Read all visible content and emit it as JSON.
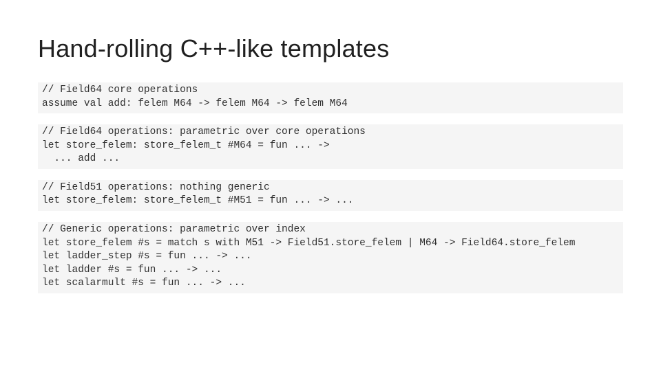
{
  "title": "Hand-rolling C++-like templates",
  "blocks": [
    "// Field64 core operations\nassume val add: felem M64 -> felem M64 -> felem M64",
    "// Field64 operations: parametric over core operations\nlet store_felem: store_felem_t #M64 = fun ... ->\n  ... add ...",
    "// Field51 operations: nothing generic\nlet store_felem: store_felem_t #M51 = fun ... -> ...",
    "// Generic operations: parametric over index\nlet store_felem #s = match s with M51 -> Field51.store_felem | M64 -> Field64.store_felem\nlet ladder_step #s = fun ... -> ...\nlet ladder #s = fun ... -> ...\nlet scalarmult #s = fun ... -> ..."
  ]
}
